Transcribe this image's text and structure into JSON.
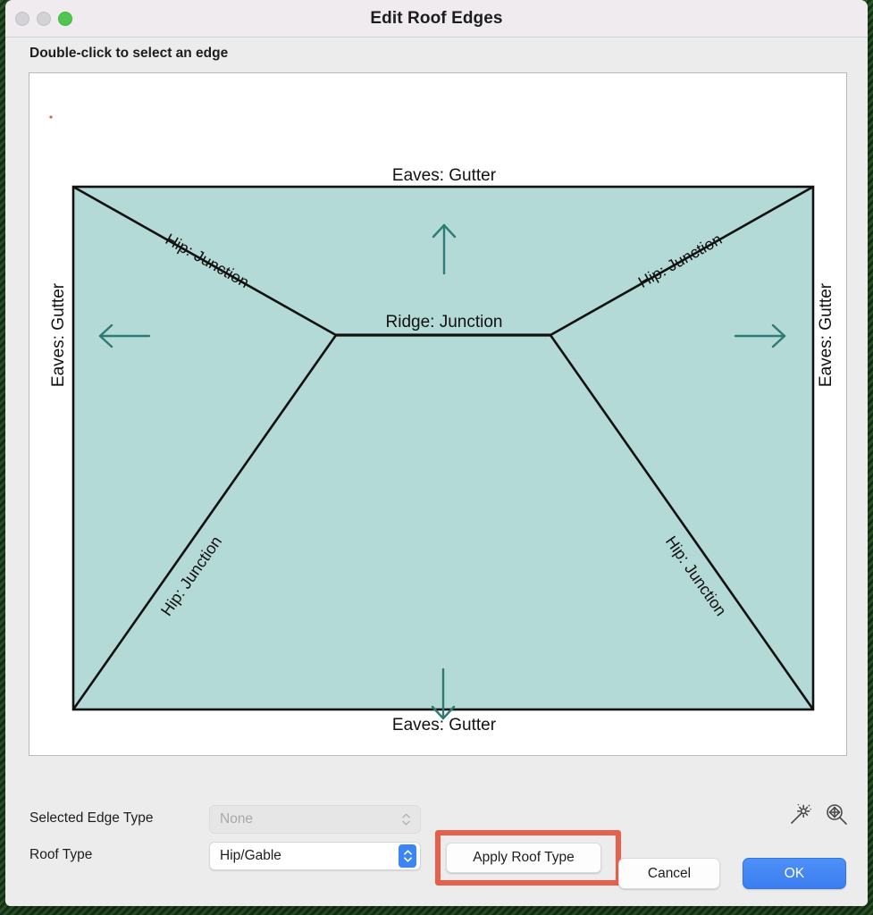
{
  "window": {
    "title": "Edit Roof Edges",
    "traffic_lights": [
      {
        "name": "close",
        "color": "#d3d2d6",
        "enabled": false
      },
      {
        "name": "minimize",
        "color": "#d3d2d6",
        "enabled": false
      },
      {
        "name": "zoom",
        "color": "#4fc74f",
        "enabled": true
      }
    ]
  },
  "instruction": "Double-click to select an edge",
  "diagram": {
    "fill_color": "#b3dad6",
    "line_color": "#111111",
    "arrow_color": "#2d7b74",
    "labels": {
      "eaves_top": "Eaves: Gutter",
      "eaves_bottom": "Eaves: Gutter",
      "eaves_left": "Eaves: Gutter",
      "eaves_right": "Eaves: Gutter",
      "ridge": "Ridge: Junction",
      "hip_top_left": "Hip: Junction",
      "hip_top_right": "Hip: Junction",
      "hip_bottom_left": "Hip: Junction",
      "hip_bottom_right": "Hip: Junction"
    }
  },
  "controls": {
    "selected_edge_type": {
      "label": "Selected Edge Type",
      "value": "None",
      "enabled": false
    },
    "roof_type": {
      "label": "Roof Type",
      "value": "Hip/Gable",
      "enabled": true
    },
    "apply_button": "Apply Roof Type",
    "highlight_color": "#e8604c",
    "tool_icons": [
      "magic-wand-icon",
      "zoom-to-fit-icon"
    ]
  },
  "footer": {
    "cancel": "Cancel",
    "ok": "OK",
    "ok_color": "#3b7ef0"
  }
}
